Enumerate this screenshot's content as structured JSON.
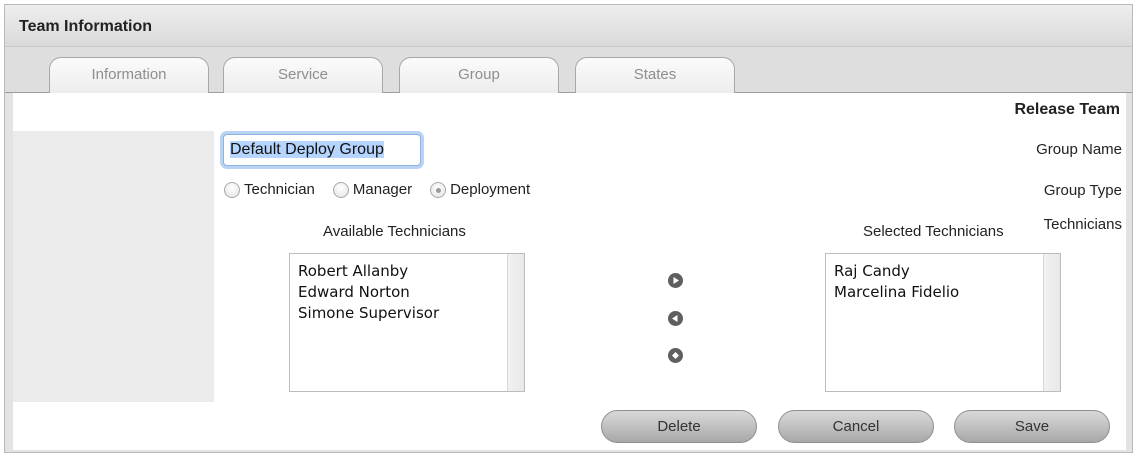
{
  "header": {
    "title": "Team Information"
  },
  "tabs": [
    {
      "label": "Information"
    },
    {
      "label": "Service"
    },
    {
      "label": "Group"
    },
    {
      "label": "States"
    }
  ],
  "panel": {
    "section_title": "Release Team"
  },
  "form": {
    "group_name_label": "Group Name",
    "group_name_value": "Default Deploy Group",
    "group_type_label": "Group Type",
    "group_type_options": [
      {
        "label": "Technician",
        "checked": false
      },
      {
        "label": "Manager",
        "checked": false
      },
      {
        "label": "Deployment",
        "checked": true
      }
    ],
    "technicians_label": "Technicians",
    "available_caption": "Available Technicians",
    "available": [
      "Robert Allanby",
      "Edward Norton",
      "Simone Supervisor"
    ],
    "selected_caption": "Selected Technicians",
    "selected": [
      "Raj Candy",
      "Marcelina Fidelio"
    ]
  },
  "transfer_icons": [
    "arrow-right-icon",
    "arrow-left-icon",
    "arrow-double-icon"
  ],
  "buttons": {
    "delete": "Delete",
    "cancel": "Cancel",
    "save": "Save"
  }
}
